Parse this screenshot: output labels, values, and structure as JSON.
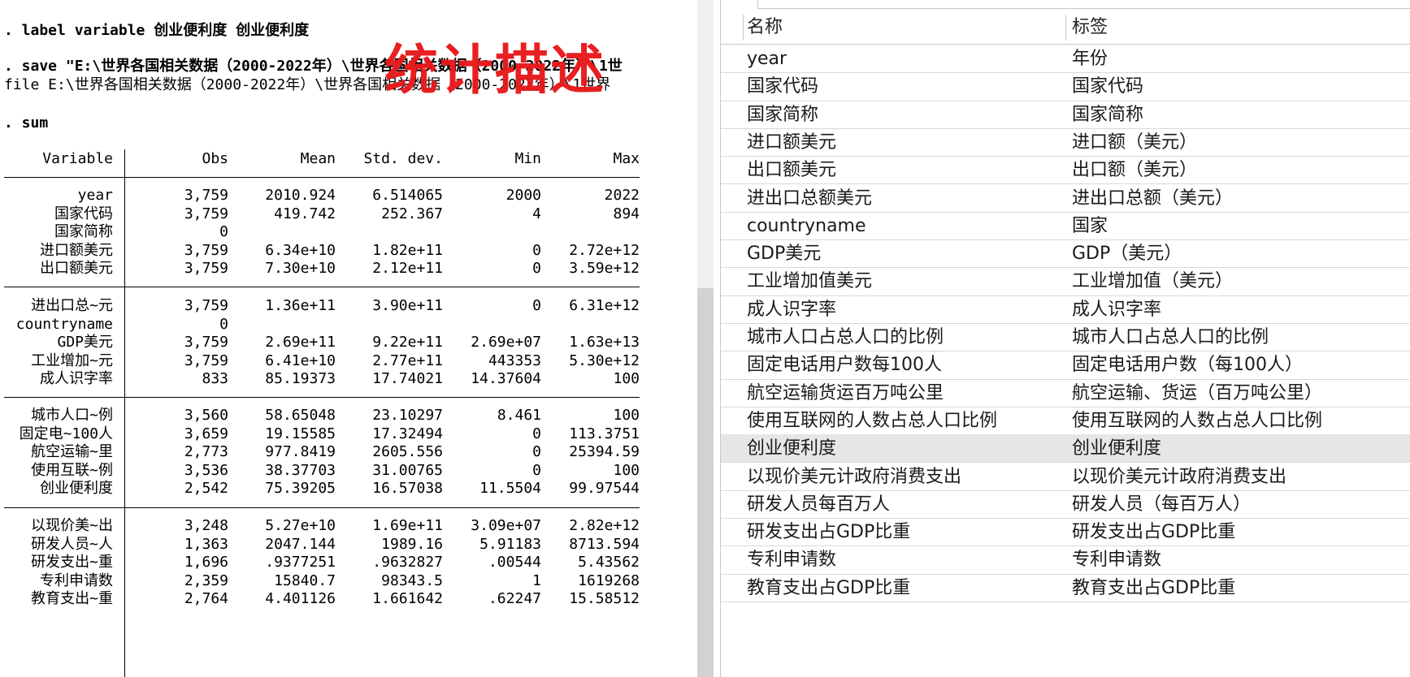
{
  "results": {
    "commands": [
      ". label variable 创业便利度 创业便利度",
      ". save \"E:\\世界各国相关数据（2000-2022年）\\世界各国相关数据（2000-2022年）\\1世",
      ". sum"
    ],
    "file_line": "file E:\\世界各国相关数据（2000-2022年）\\世界各国相关数据（2000-2022年）\\1世界",
    "overlay_title": "统计描述",
    "overlay_color": "#e8191b",
    "headers": [
      "Variable",
      "Obs",
      "Mean",
      "Std. dev.",
      "Min",
      "Max"
    ],
    "rows": [
      [
        "year",
        "3,759",
        "2010.924",
        "6.514065",
        "2000",
        "2022"
      ],
      [
        "国家代码",
        "3,759",
        "419.742",
        "252.367",
        "4",
        "894"
      ],
      [
        "国家简称",
        "0",
        "",
        "",
        "",
        ""
      ],
      [
        "进口额美元",
        "3,759",
        "6.34e+10",
        "1.82e+11",
        "0",
        "2.72e+12"
      ],
      [
        "出口额美元",
        "3,759",
        "7.30e+10",
        "2.12e+11",
        "0",
        "3.59e+12"
      ],
      [
        "进出口总~元",
        "3,759",
        "1.36e+11",
        "3.90e+11",
        "0",
        "6.31e+12"
      ],
      [
        "countryname",
        "0",
        "",
        "",
        "",
        ""
      ],
      [
        "GDP美元",
        "3,759",
        "2.69e+11",
        "9.22e+11",
        "2.69e+07",
        "1.63e+13"
      ],
      [
        "工业增加~元",
        "3,759",
        "6.41e+10",
        "2.77e+11",
        "443353",
        "5.30e+12"
      ],
      [
        "成人识字率",
        "833",
        "85.19373",
        "17.74021",
        "14.37604",
        "100"
      ],
      [
        "城市人口~例",
        "3,560",
        "58.65048",
        "23.10297",
        "8.461",
        "100"
      ],
      [
        "固定电~100人",
        "3,659",
        "19.15585",
        "17.32494",
        "0",
        "113.3751"
      ],
      [
        "航空运输~里",
        "2,773",
        "977.8419",
        "2605.556",
        "0",
        "25394.59"
      ],
      [
        "使用互联~例",
        "3,536",
        "38.37703",
        "31.00765",
        "0",
        "100"
      ],
      [
        "创业便利度",
        "2,542",
        "75.39205",
        "16.57038",
        "11.5504",
        "99.97544"
      ],
      [
        "以现价美~出",
        "3,248",
        "5.27e+10",
        "1.69e+11",
        "3.09e+07",
        "2.82e+12"
      ],
      [
        "研发人员~人",
        "1,363",
        "2047.144",
        "1989.16",
        "5.91183",
        "8713.594"
      ],
      [
        "研发支出~重",
        "1,696",
        ".9377251",
        ".9632827",
        ".00544",
        "5.43562"
      ],
      [
        "专利申请数",
        "2,359",
        "15840.7",
        "98343.5",
        "1",
        "1619268"
      ],
      [
        "教育支出~重",
        "2,764",
        "4.401126",
        "1.661642",
        ".62247",
        "15.58512"
      ]
    ]
  },
  "variables": {
    "header_name": "名称",
    "header_label": "标签",
    "selected_index": 14,
    "items": [
      {
        "name": "year",
        "label": "年份"
      },
      {
        "name": "国家代码",
        "label": "国家代码"
      },
      {
        "name": "国家简称",
        "label": "国家简称"
      },
      {
        "name": "进口额美元",
        "label": "进口额（美元）"
      },
      {
        "name": "出口额美元",
        "label": "出口额（美元）"
      },
      {
        "name": "进出口总额美元",
        "label": "进出口总额（美元）"
      },
      {
        "name": "countryname",
        "label": "国家"
      },
      {
        "name": "GDP美元",
        "label": "GDP（美元）"
      },
      {
        "name": "工业增加值美元",
        "label": "工业增加值（美元）"
      },
      {
        "name": "成人识字率",
        "label": "成人识字率"
      },
      {
        "name": "城市人口占总人口的比例",
        "label": "城市人口占总人口的比例"
      },
      {
        "name": "固定电话用户数每100人",
        "label": "固定电话用户数（每100人）"
      },
      {
        "name": "航空运输货运百万吨公里",
        "label": "航空运输、货运（百万吨公里）"
      },
      {
        "name": "使用互联网的人数占总人口比例",
        "label": "使用互联网的人数占总人口比例"
      },
      {
        "name": "创业便利度",
        "label": "创业便利度"
      },
      {
        "name": "以现价美元计政府消费支出",
        "label": "以现价美元计政府消费支出"
      },
      {
        "name": "研发人员每百万人",
        "label": "研发人员（每百万人）"
      },
      {
        "name": "研发支出占GDP比重",
        "label": "研发支出占GDP比重"
      },
      {
        "name": "专利申请数",
        "label": "专利申请数"
      },
      {
        "name": "教育支出占GDP比重",
        "label": "教育支出占GDP比重"
      }
    ]
  }
}
